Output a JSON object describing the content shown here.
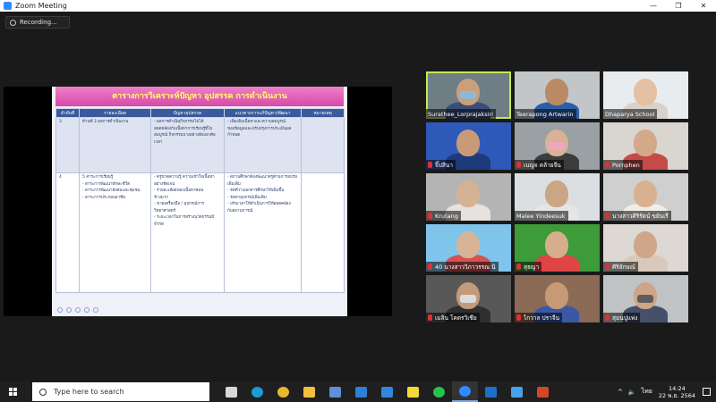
{
  "window": {
    "title": "Zoom Meeting",
    "controls": [
      "—",
      "❐",
      "✕"
    ]
  },
  "recording": {
    "label": "Recording..."
  },
  "slide": {
    "title": "ตารางการวิเคราะห์ปัญหา อุปสรรค การดำเนินงาน",
    "headers": [
      "ลำดับที่",
      "รายละเอียด",
      "ปัญหาอุปสรรค",
      "แนวทางการแก้ปัญหา/พัฒนา",
      "หมายเหตุ"
    ],
    "rows": [
      {
        "no": "3",
        "detail": [
          "ด้านที่ 3 ผลการดำเนินงาน"
        ],
        "problem": [
          "- ผลการดำเนินกิจกรรมไม่ได้",
          "สอดคล้องกับเนื้อหาการเรียนรู้ที่ไม่",
          "สมบูรณ์ กิจกรรมบางอย่างต้องอาศัย",
          "เวลา"
        ],
        "solution": [
          "- เพิ่มเติมเนื้อหาและความสมบูรณ์",
          "ของข้อมูลและปรับปรุงการประเมินผล",
          "กำหนด"
        ],
        "note": [
          ""
        ]
      },
      {
        "no": "4",
        "detail": [
          "5 สาระการเรียนรู้",
          "- สาระการพัฒนาทักษะชีวิต",
          "- สาระการพัฒนาสังคมและชุมชน",
          "- สาระการประกอบอาชีพ"
        ],
        "problem": [
          "- ครูขาดความรู้ ความเข้าใจเนื้อหา",
          "อย่างชัดเจน",
          "- รายละเอียดของเนื้อหาค่อน",
          "ข้างมาก",
          "- ขาดเครื่องมือ / อุปกรณ์การ",
          "วิทยาศาสตร์",
          "- ระยะเวลาในการสร้างนวัตกรรมมี",
          "จำกัด"
        ],
        "solution": [
          "- สถานศึกษาต้องพัฒนาครูด้านการอบรม",
          "เพิ่มเติม",
          "- จัดที่วางเอกสารศึกษาให้เพิ่มขึ้น",
          "",
          "- จัดหาอุปกรณ์เพิ่มเติม",
          "",
          "- ปรับเวลาให้ดำเนินการให้สอดคล้อง",
          "กับสถานการณ์"
        ],
        "note": [
          ""
        ]
      }
    ]
  },
  "participants": [
    {
      "name": "Surathee_Lorprajaksiri",
      "muted": false,
      "active": true,
      "bg": "#6f7d85",
      "skin": "#c9a07a",
      "shirt": "#3b4c7a",
      "mask": "#8fb8d6"
    },
    {
      "name": "Teerapong Artwarin",
      "muted": false,
      "active": false,
      "bg": "#c2c6c9",
      "skin": "#b98a63",
      "shirt": "#2a5fa8",
      "mask": ""
    },
    {
      "name": "Dhaparya School",
      "muted": false,
      "active": false,
      "bg": "#e8ecef",
      "skin": "#e3c0a2",
      "shirt": "#d9d2cc",
      "mask": ""
    },
    {
      "name": "จิ๊ปสินา",
      "muted": true,
      "active": false,
      "bg": "#2e59b8",
      "skin": "#c99a78",
      "shirt": "#1d3b7a",
      "mask": ""
    },
    {
      "name": "เบญจ คล้ายจีน",
      "muted": true,
      "active": false,
      "bg": "#9aa0a3",
      "skin": "#d8b196",
      "shirt": "#3c3c3c",
      "mask": "#f2a6bd"
    },
    {
      "name": "Pornphen",
      "muted": true,
      "active": false,
      "bg": "#d9d5cf",
      "skin": "#d3a98a",
      "shirt": "#c64a4a",
      "mask": ""
    },
    {
      "name": "Krutang",
      "muted": true,
      "active": false,
      "bg": "#b4b4b4",
      "skin": "#d6b294",
      "shirt": "#e8e2df",
      "mask": ""
    },
    {
      "name": "Malee Yindeesuk",
      "muted": false,
      "active": false,
      "bg": "#dcdfe2",
      "skin": "#caa685",
      "shirt": "#e5e5e5",
      "mask": ""
    },
    {
      "name": "นางสาวศิริรัตน์ ขยันเรี",
      "muted": true,
      "active": false,
      "bg": "#cfcfcf",
      "skin": "#d8b290",
      "shirt": "#f0ece6",
      "mask": ""
    },
    {
      "name": "40 นางสาววิภาวรรณ นิ",
      "muted": true,
      "active": false,
      "bg": "#7fc4ea",
      "skin": "#d7b497",
      "shirt": "#d25353",
      "mask": ""
    },
    {
      "name": "สุธญา",
      "muted": true,
      "active": false,
      "bg": "#3d9b3a",
      "skin": "#d6ae8e",
      "shirt": "#e04444",
      "mask": ""
    },
    {
      "name": "ศิริลักษณ์",
      "muted": true,
      "active": false,
      "bg": "#ddd8d3",
      "skin": "#d0a689",
      "shirt": "#d9c9ba",
      "mask": ""
    },
    {
      "name": "เมลิน โคตรวิเชีย",
      "muted": true,
      "active": false,
      "bg": "#585858",
      "skin": "#c29b7c",
      "shirt": "#2f2f2f",
      "mask": "#dcdcdc"
    },
    {
      "name": "ไกวาล ปราจีน",
      "muted": true,
      "active": false,
      "bg": "#8b6a56",
      "skin": "#c79a76",
      "shirt": "#3a58a6",
      "mask": ""
    },
    {
      "name": "สุมนปูแพ่ง",
      "muted": true,
      "active": false,
      "bg": "#bfc3c6",
      "skin": "#cfa587",
      "shirt": "#46506b",
      "mask": "#5d5d5d"
    }
  ],
  "taskbar": {
    "search_placeholder": "Type here to search",
    "apps": [
      {
        "name": "task-view",
        "color": "#d9d9d9"
      },
      {
        "name": "edge",
        "color": "#1c9bd6"
      },
      {
        "name": "chrome",
        "color": "#e6b82f"
      },
      {
        "name": "explorer",
        "color": "#f2c13c"
      },
      {
        "name": "store",
        "color": "#5f8fd9"
      },
      {
        "name": "mail",
        "color": "#2f7fd6"
      },
      {
        "name": "calendar",
        "color": "#2f87e0"
      },
      {
        "name": "sticky",
        "color": "#f4d93a"
      },
      {
        "name": "line",
        "color": "#28c24b"
      },
      {
        "name": "zoom",
        "color": "#2d8cff"
      },
      {
        "name": "outlook",
        "color": "#1e6fc8"
      },
      {
        "name": "photos",
        "color": "#4aa0e8"
      },
      {
        "name": "powerpoint",
        "color": "#d24726"
      }
    ],
    "tray": {
      "chevron": "^",
      "lang": "ไทย",
      "time": "14:24",
      "date": "22 พ.ย. 2564"
    }
  }
}
